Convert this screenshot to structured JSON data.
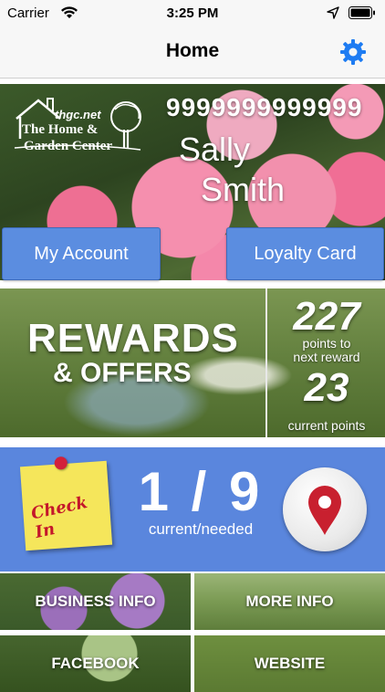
{
  "status_bar": {
    "carrier": "Carrier",
    "time": "3:25 PM"
  },
  "nav": {
    "title": "Home"
  },
  "hero": {
    "logo_url_text": "thgc.net",
    "logo_line1": "The Home &",
    "logo_line2": "Garden Center",
    "card_number": "9999999999999",
    "first_name": "Sally",
    "last_name": "Smith"
  },
  "buttons": {
    "my_account": "My Account",
    "loyalty_card": "Loyalty Card"
  },
  "rewards": {
    "title": "REWARDS",
    "subtitle": "& OFFERS",
    "points_to_next": "227",
    "points_to_next_label_1": "points to",
    "points_to_next_label_2": "next reward",
    "current_points": "23",
    "current_points_label": "current points"
  },
  "checkin": {
    "note_text": "Check In",
    "count": "1 / 9",
    "count_label": "current/needed"
  },
  "tiles": {
    "business_info": "BUSINESS INFO",
    "more_info": "MORE INFO",
    "facebook": "FACEBOOK",
    "website": "WEBSITE"
  },
  "colors": {
    "accent_blue": "#5b8de0",
    "checkin_bg": "#5a86dd",
    "gear_blue": "#1e7cf2",
    "pin_red": "#c8202f"
  },
  "icons": {
    "settings": "gear-icon",
    "wifi": "wifi-icon",
    "location": "location-arrow-icon",
    "battery": "battery-icon",
    "map": "map-pin-icon"
  }
}
